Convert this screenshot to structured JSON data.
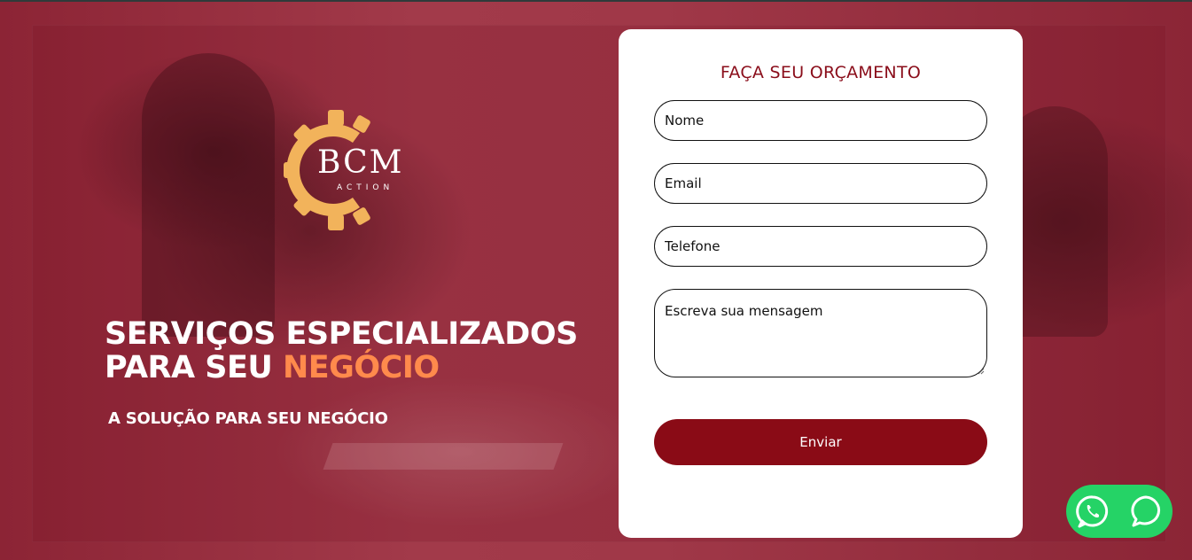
{
  "brand": {
    "logo_text": "BCM",
    "logo_subtext": "ACTION",
    "gear_color": "#f2b35b"
  },
  "hero": {
    "headline_line1": "SERVIÇOS ESPECIALIZADOS",
    "headline_line2_prefix": "PARA SEU ",
    "headline_line2_accent": "NEGÓCIO",
    "subheadline": "A SOLUÇÃO PARA SEU NEGÓCIO",
    "accent_color": "#ff8a4c"
  },
  "form": {
    "title": "FAÇA SEU ORÇAMENTO",
    "fields": {
      "name_placeholder": "Nome",
      "email_placeholder": "Email",
      "phone_placeholder": "Telefone",
      "message_placeholder": "Escreva sua mensagem"
    },
    "submit_label": "Enviar",
    "primary_color": "#8a0b16"
  },
  "chat_widget": {
    "color": "#25d366",
    "icons": [
      "whatsapp-icon",
      "chat-bubble-icon"
    ]
  }
}
